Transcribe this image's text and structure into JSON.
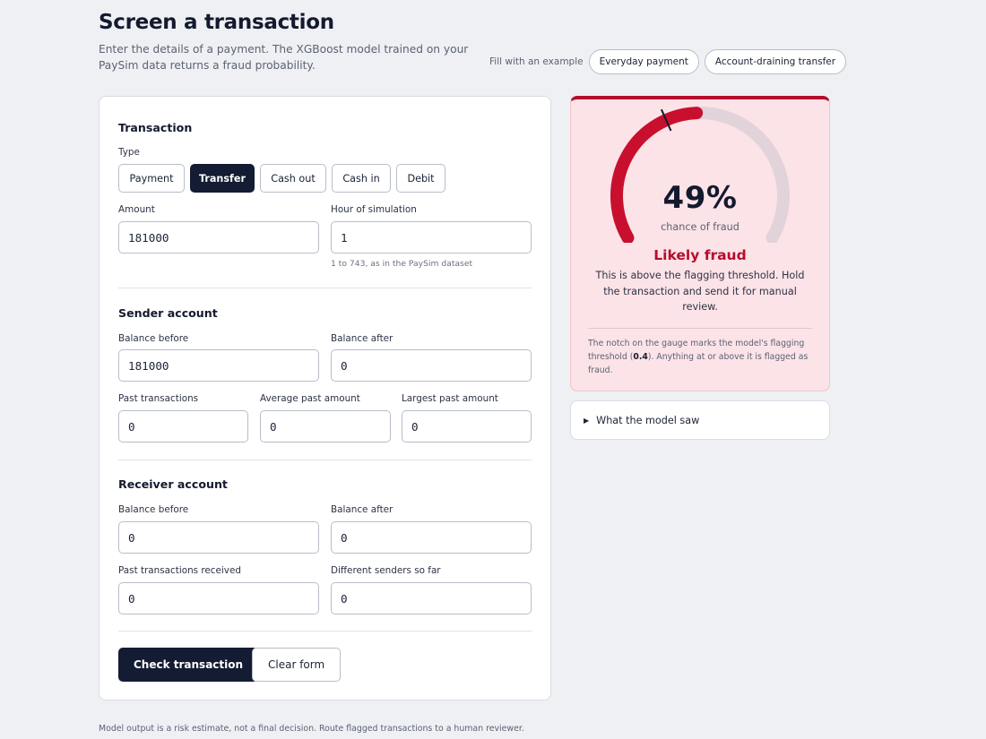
{
  "header": {
    "title": "Screen a transaction",
    "subtitle": "Enter the details of a payment. The XGBoost model trained on your PaySim data returns a fraud probability."
  },
  "examples": {
    "label": "Fill with an example",
    "buttons": [
      "Everyday payment",
      "Account-draining transfer"
    ]
  },
  "transaction": {
    "section_title": "Transaction",
    "type_label": "Type",
    "types": [
      "Payment",
      "Transfer",
      "Cash out",
      "Cash in",
      "Debit"
    ],
    "selected_type": "Transfer",
    "amount_label": "Amount",
    "amount_value": "181000",
    "hour_label": "Hour of simulation",
    "hour_value": "1",
    "hour_hint": "1 to 743, as in the PaySim dataset"
  },
  "sender": {
    "section_title": "Sender account",
    "balance_before_label": "Balance before",
    "balance_before_value": "181000",
    "balance_after_label": "Balance after",
    "balance_after_value": "0",
    "past_tx_label": "Past transactions",
    "past_tx_value": "0",
    "avg_past_label": "Average past amount",
    "avg_past_value": "0",
    "max_past_label": "Largest past amount",
    "max_past_value": "0"
  },
  "receiver": {
    "section_title": "Receiver account",
    "balance_before_label": "Balance before",
    "balance_before_value": "0",
    "balance_after_label": "Balance after",
    "balance_after_value": "0",
    "past_received_label": "Past transactions received",
    "past_received_value": "0",
    "senders_label": "Different senders so far",
    "senders_value": "0"
  },
  "actions": {
    "check_label": "Check transaction",
    "clear_label": "Clear form"
  },
  "result": {
    "probability": 0.49,
    "threshold": 0.4,
    "percent_text": "49%",
    "percent_caption": "chance of fraud",
    "verdict": "Likely fraud",
    "verdict_desc": "This is above the flagging threshold. Hold the transaction and send it for manual review.",
    "note_before": "The notch on the gauge marks the model's flagging threshold (",
    "note_threshold": "0.4",
    "note_after": "). Anything at or above it is flagged as fraud.",
    "colors": {
      "fill": "#c8102e",
      "track": "#e2d3da",
      "notch": "#141a2e"
    }
  },
  "details": {
    "icon": "triangle-right-icon",
    "label": "What the model saw"
  },
  "footer": {
    "text": "Model output is a risk estimate, not a final decision. Route flagged transactions to a human reviewer."
  }
}
